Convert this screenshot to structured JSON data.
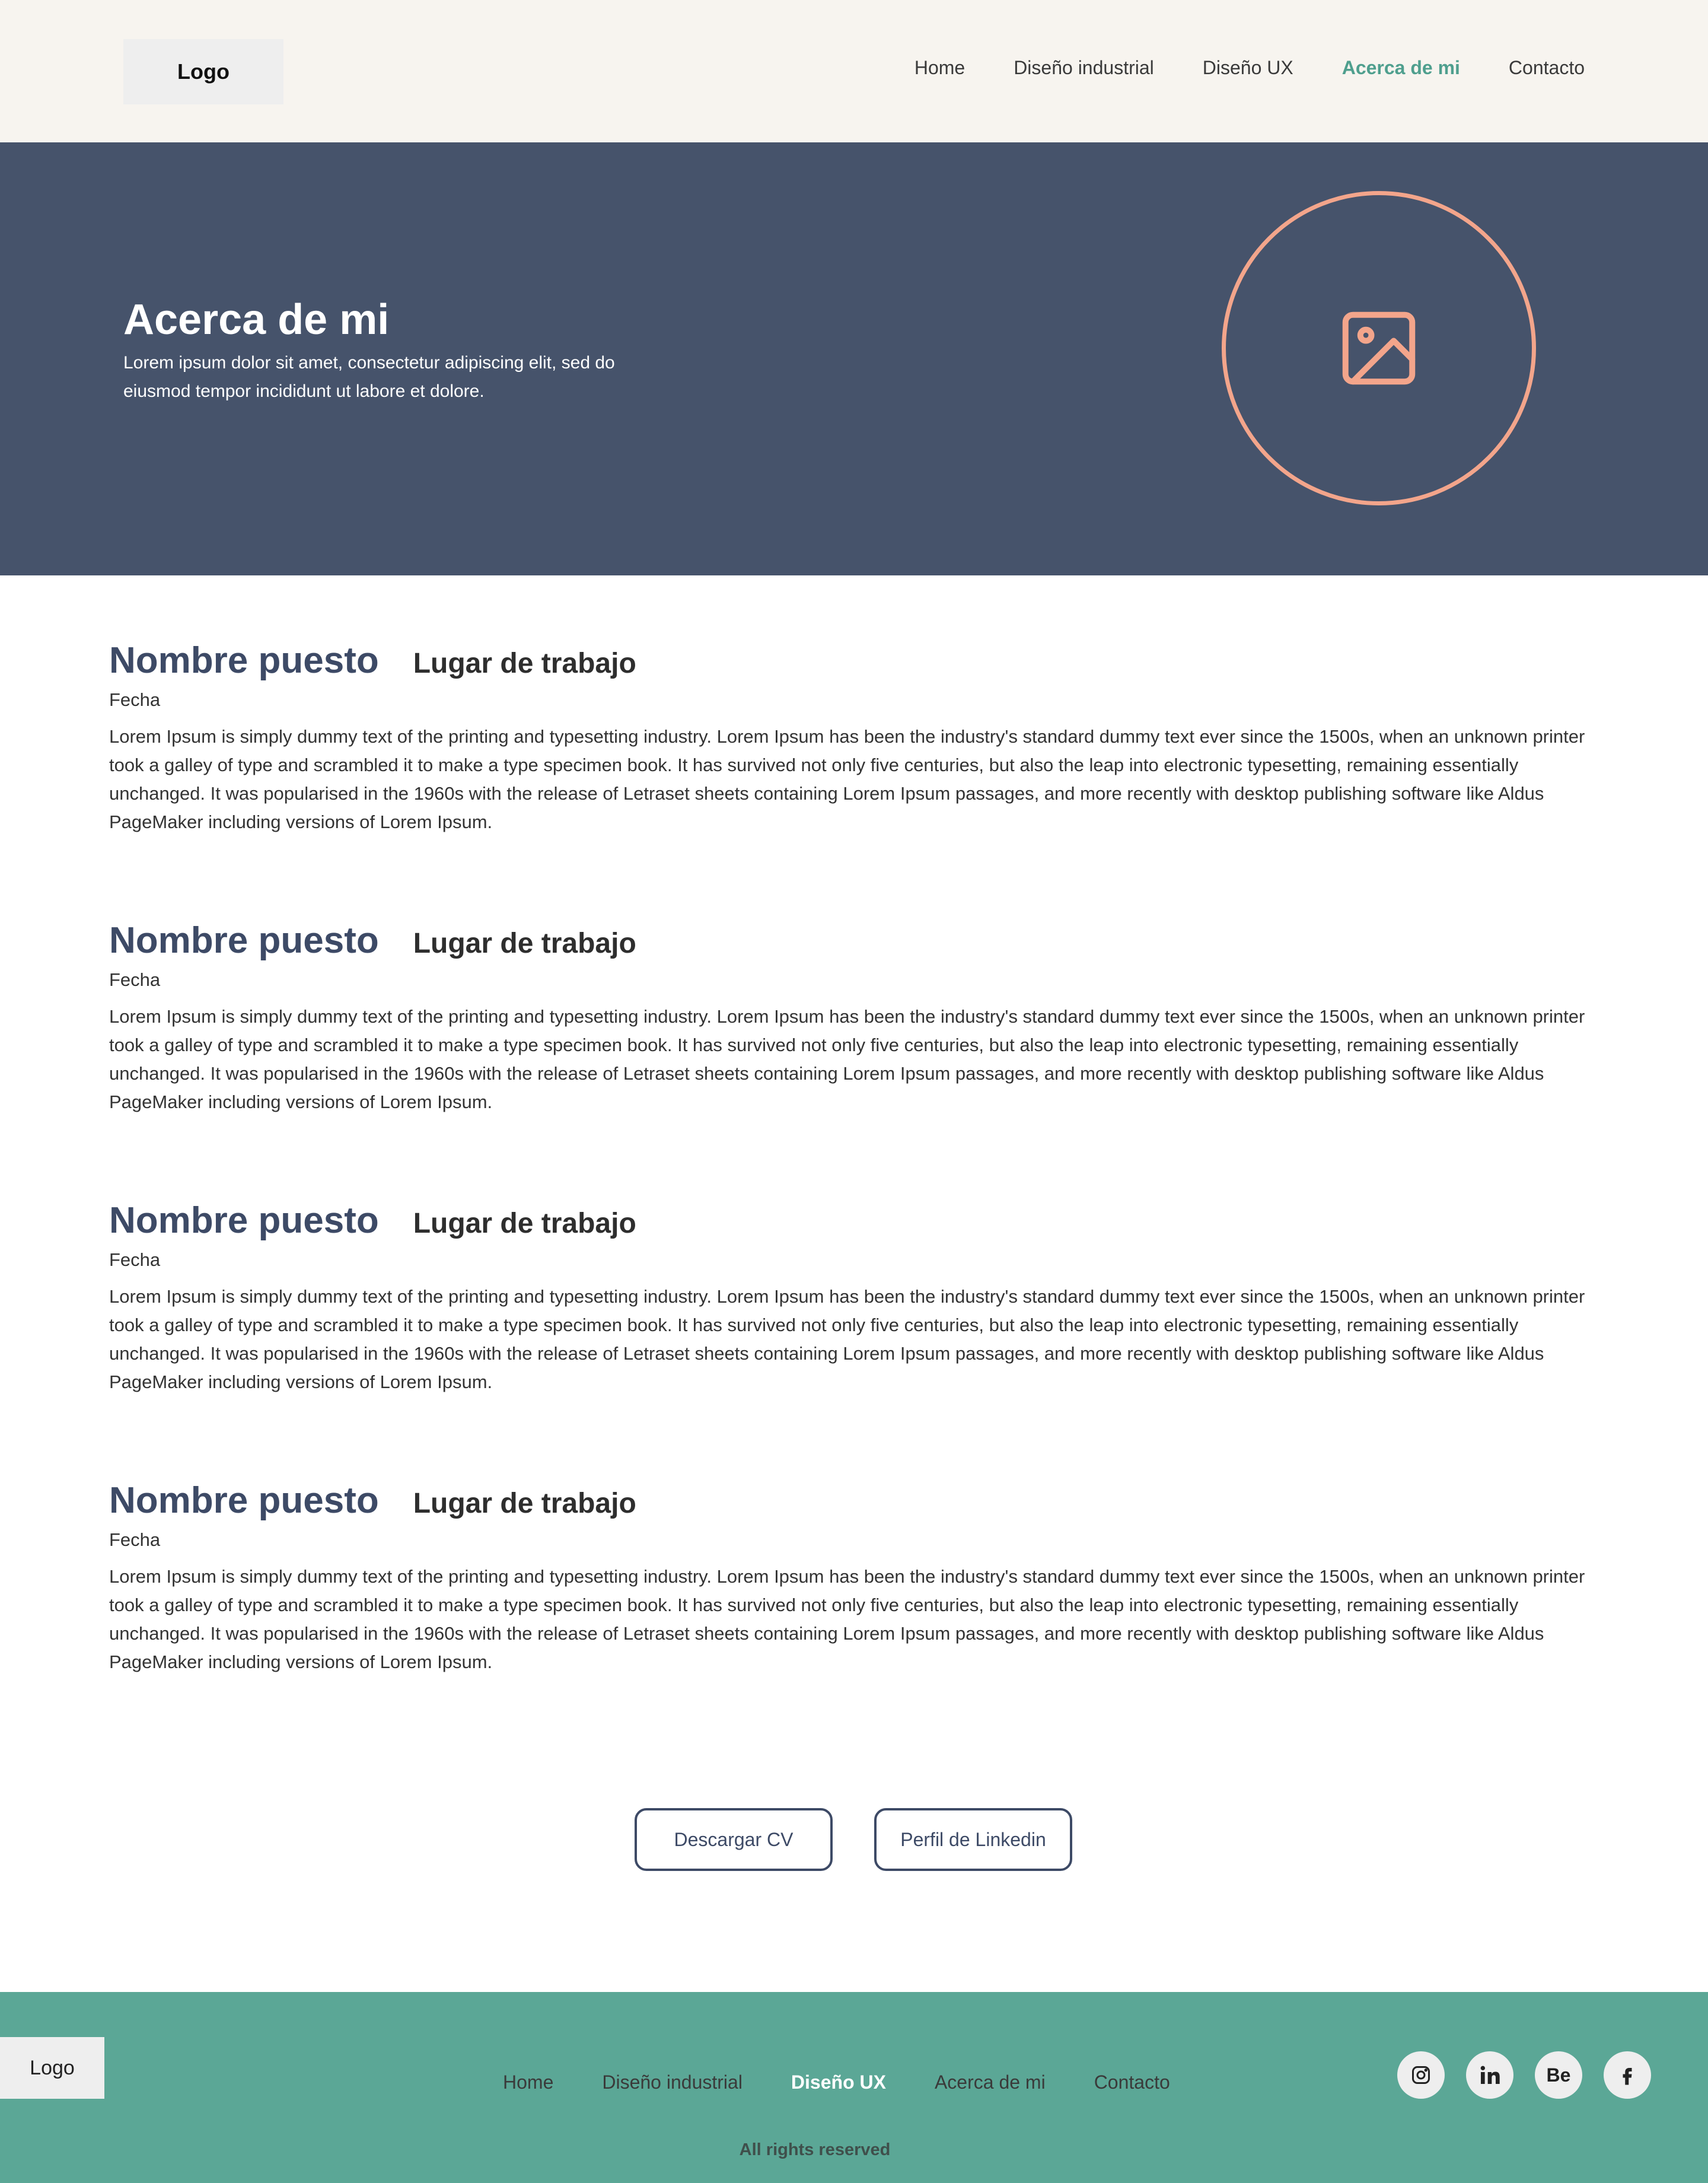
{
  "header": {
    "logo": "Logo",
    "nav": [
      "Home",
      "Diseño industrial",
      "Diseño UX",
      "Acerca de mi",
      "Contacto"
    ],
    "active_nav": "Acerca de mi"
  },
  "hero": {
    "title": "Acerca de mi",
    "text": "Lorem ipsum dolor sit amet, consectetur adipiscing elit, sed do eiusmod tempor incididunt ut labore et dolore.",
    "image_icon": "image-placeholder-icon"
  },
  "jobs": [
    {
      "title": "Nombre puesto",
      "place": "Lugar de trabajo",
      "date": "Fecha",
      "description": "Lorem Ipsum is simply dummy text of the printing and typesetting industry. Lorem Ipsum has been the industry's standard dummy text ever since the 1500s, when an unknown printer took a galley of type and scrambled it to make a type specimen book. It has survived not only five centuries, but also the leap into electronic typesetting, remaining essentially unchanged. It was popularised in the 1960s with the release of Letraset sheets containing Lorem Ipsum passages, and more recently with desktop publishing software like Aldus PageMaker including versions of Lorem Ipsum."
    },
    {
      "title": "Nombre puesto",
      "place": "Lugar de trabajo",
      "date": "Fecha",
      "description": "Lorem Ipsum is simply dummy text of the printing and typesetting industry. Lorem Ipsum has been the industry's standard dummy text ever since the 1500s, when an unknown printer took a galley of type and scrambled it to make a type specimen book. It has survived not only five centuries, but also the leap into electronic typesetting, remaining essentially unchanged. It was popularised in the 1960s with the release of Letraset sheets containing Lorem Ipsum passages, and more recently with desktop publishing software like Aldus PageMaker including versions of Lorem Ipsum."
    },
    {
      "title": "Nombre puesto",
      "place": "Lugar de trabajo",
      "date": "Fecha",
      "description": "Lorem Ipsum is simply dummy text of the printing and typesetting industry. Lorem Ipsum has been the industry's standard dummy text ever since the 1500s, when an unknown printer took a galley of type and scrambled it to make a type specimen book. It has survived not only five centuries, but also the leap into electronic typesetting, remaining essentially unchanged. It was popularised in the 1960s with the release of Letraset sheets containing Lorem Ipsum passages, and more recently with desktop publishing software like Aldus PageMaker including versions of Lorem Ipsum."
    },
    {
      "title": "Nombre puesto",
      "place": "Lugar de trabajo",
      "date": "Fecha",
      "description": "Lorem Ipsum is simply dummy text of the printing and typesetting industry. Lorem Ipsum has been the industry's standard dummy text ever since the 1500s, when an unknown printer took a galley of type and scrambled it to make a type specimen book. It has survived not only five centuries, but also the leap into electronic typesetting, remaining essentially unchanged. It was popularised in the 1960s with the release of Letraset sheets containing Lorem Ipsum passages, and more recently with desktop publishing software like Aldus PageMaker including versions of Lorem Ipsum."
    }
  ],
  "actions": {
    "download_cv": "Descargar CV",
    "linkedin_profile": "Perfil de Linkedin"
  },
  "footer": {
    "logo": "Logo",
    "nav": [
      "Home",
      "Diseño industrial",
      "Diseño UX",
      "Acerca de mi",
      "Contacto"
    ],
    "active_nav": "Diseño UX",
    "social": [
      "instagram-icon",
      "linkedin-icon",
      "behance-icon",
      "facebook-icon"
    ],
    "behance_label": "Be",
    "copyright": "All rights reserved"
  },
  "colors": {
    "header_bg": "#f7f4ef",
    "hero_bg": "#46536b",
    "accent_teal": "#5ba796",
    "accent_salmon": "#f3a58b",
    "title_navy": "#3d4a66"
  }
}
